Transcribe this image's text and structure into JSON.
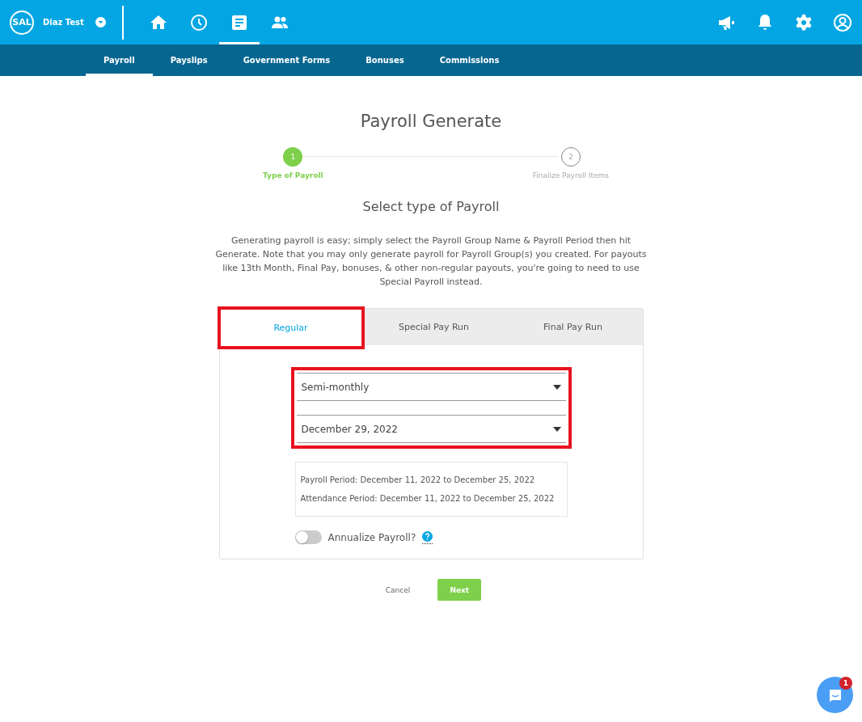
{
  "header": {
    "logo": "SAL",
    "account": "Diaz Test",
    "nav_icons": [
      {
        "kind": "home",
        "selected": false
      },
      {
        "kind": "clock",
        "selected": false
      },
      {
        "kind": "document",
        "selected": true
      },
      {
        "kind": "people",
        "selected": false
      }
    ],
    "right_icons": [
      {
        "kind": "megaphone"
      },
      {
        "kind": "bell"
      },
      {
        "kind": "gear"
      },
      {
        "kind": "user"
      }
    ]
  },
  "subnav": [
    {
      "label": "Payroll",
      "selected": true
    },
    {
      "label": "Payslips",
      "selected": false
    },
    {
      "label": "Government Forms",
      "selected": false
    },
    {
      "label": "Bonuses",
      "selected": false
    },
    {
      "label": "Commissions",
      "selected": false
    }
  ],
  "title": "Payroll Generate",
  "steps": [
    {
      "number": "1",
      "label": "Type of Payroll",
      "selected": true
    },
    {
      "number": "2",
      "label": "Finalize Payroll Items",
      "selected": false
    }
  ],
  "subtitle": "Select type of Payroll",
  "description": "Generating payroll is easy; simply select the Payroll Group Name & Payroll Period then hit Generate. Note that you may only generate payroll for Payroll Group(s) you created. For payouts like 13th Month, Final Pay, bonuses, & other non-regular payouts, you're going to need to use Special Payroll instead.",
  "tabs": [
    {
      "label": "Regular",
      "selected": true,
      "highlighted": true
    },
    {
      "label": "Special Pay Run",
      "selected": false,
      "highlighted": false
    },
    {
      "label": "Final Pay Run",
      "selected": false,
      "highlighted": false
    }
  ],
  "selects_highlighted": true,
  "selects": [
    {
      "value": "Semi-monthly"
    },
    {
      "value": "December 29, 2022"
    }
  ],
  "period_lines": [
    "Payroll Period: December 11, 2022 to December 25, 2022",
    "Attendance Period: December 11, 2022 to December 25, 2022"
  ],
  "annualize": {
    "label": "Annualize Payroll?",
    "on": false
  },
  "buttons": {
    "cancel": "Cancel",
    "next": "Next"
  },
  "chat": {
    "badge": "1"
  }
}
